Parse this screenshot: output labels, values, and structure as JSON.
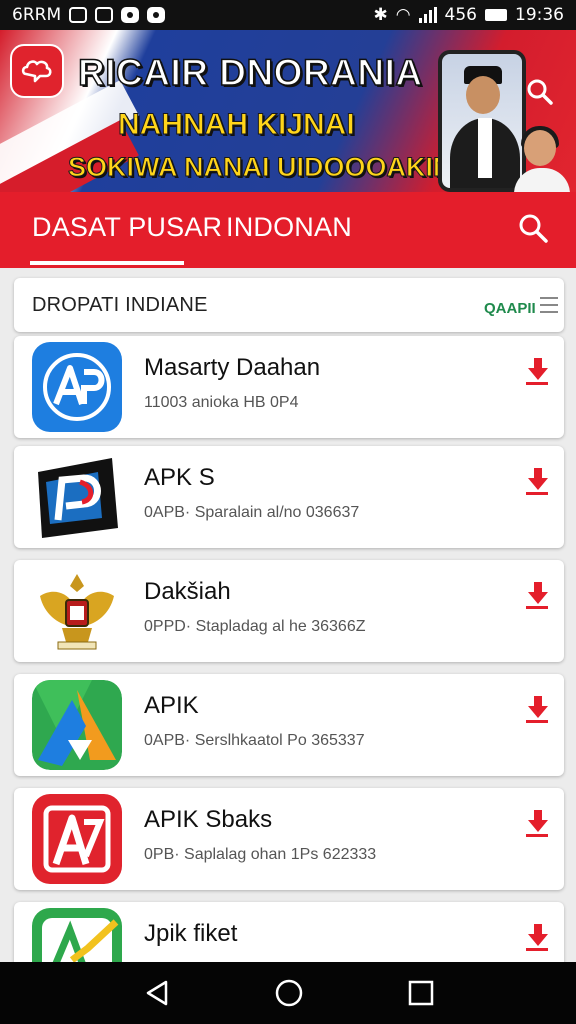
{
  "status_bar": {
    "carrier": "6RRM",
    "battery_percent": "456",
    "time": "19:36"
  },
  "banner": {
    "title": "RICAIR DNORANIA",
    "subtitle_1": "NAHNAH KIJNAI",
    "subtitle_2": "SOKIWA NANAI UIDOOOAKIN",
    "logo_icon": "chat-cloud-icon",
    "colors": {
      "red": "#e41e2b",
      "blue": "#243f96",
      "yellow": "#ffd51a"
    }
  },
  "nav": {
    "tabs": [
      {
        "label": "DASAT PUSAR",
        "active": true
      },
      {
        "label": "INDONAN",
        "active": false
      }
    ],
    "accent": "#e41e2b"
  },
  "section": {
    "title": "DROPATI INDIANE",
    "action": "QAAPII"
  },
  "apps": [
    {
      "name": "Masarty Daahan",
      "meta": "11003 anioka HB 0P4",
      "icon": "app-ap-blue-icon"
    },
    {
      "name": "APK S",
      "meta": "0APB· Sparalain al/no 036637",
      "icon": "app-p-black-icon"
    },
    {
      "name": "Dakšiah",
      "meta": "0PPD· Stapladag al he 36366Z",
      "icon": "garuda-emblem-icon"
    },
    {
      "name": "APIK",
      "meta": "0APB· Serslhkaatol Po 365337",
      "icon": "app-triangle-multicolor-icon"
    },
    {
      "name": "APIK Sbaks",
      "meta": "0PB· Saplalag ohan 1Ps 622333",
      "icon": "app-a-red-icon"
    },
    {
      "name": "Jpik fiket",
      "meta": "",
      "icon": "app-green-check-icon"
    }
  ]
}
